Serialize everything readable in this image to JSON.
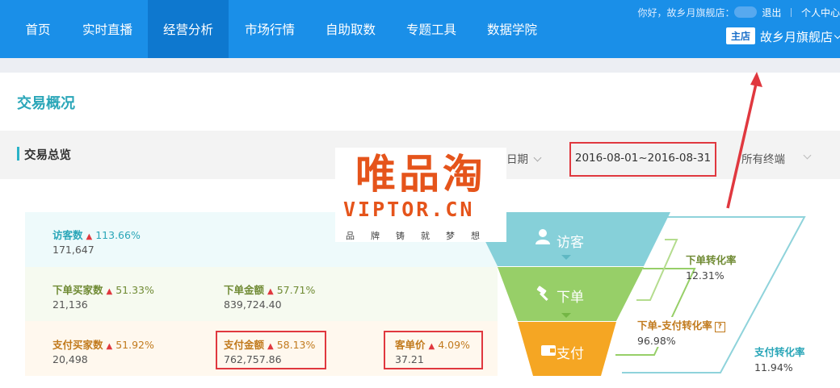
{
  "nav": {
    "items": [
      "首页",
      "实时直播",
      "经营分析",
      "市场行情",
      "自助取数",
      "专题工具",
      "数据学院"
    ],
    "active_index": 2
  },
  "user_bar": {
    "greeting": "你好，故乡月旗舰店：",
    "logout": "退出",
    "personal_center": "个人中心"
  },
  "shop": {
    "badge": "主店",
    "name": "故乡月旗舰店"
  },
  "page_title": "交易概况",
  "section": {
    "title": "交易总览",
    "date_label": "日期",
    "date_range": "2016-08-01~2016-08-31",
    "terminal": "所有终端"
  },
  "watermark": {
    "brand": "唯品淘",
    "domain": "VIPTOR.CN",
    "slogan": [
      "品",
      "牌",
      "铸",
      "就",
      "梦",
      "想"
    ]
  },
  "metrics": {
    "visitors": {
      "label": "访客数",
      "change": "113.66%",
      "value": "171,647"
    },
    "order_buyers": {
      "label": "下单买家数",
      "change": "51.33%",
      "value": "21,136"
    },
    "order_amount": {
      "label": "下单金额",
      "change": "57.71%",
      "value": "839,724.40"
    },
    "pay_buyers": {
      "label": "支付买家数",
      "change": "51.92%",
      "value": "20,498"
    },
    "pay_amount": {
      "label": "支付金额",
      "change": "58.13%",
      "value": "762,757.86"
    },
    "unit_price": {
      "label": "客单价",
      "change": "4.09%",
      "value": "37.21"
    }
  },
  "funnel": {
    "visit_label": "访客",
    "order_label": "下单",
    "pay_label": "支付",
    "colors": {
      "visit": "#86d0d9",
      "order": "#97cf68",
      "pay": "#f5a623",
      "accent_red": "#e0383f"
    }
  },
  "conversions": {
    "order_rate": {
      "label": "下单转化率",
      "value": "12.31%"
    },
    "order_pay_rate": {
      "label": "下单-支付转化率",
      "value": "96.98%"
    },
    "pay_rate": {
      "label": "支付转化率",
      "value": "11.94%"
    }
  },
  "icons": {
    "user": "user-icon",
    "hammer": "hammer-icon",
    "wallet": "wallet-icon",
    "help": "help-icon"
  }
}
